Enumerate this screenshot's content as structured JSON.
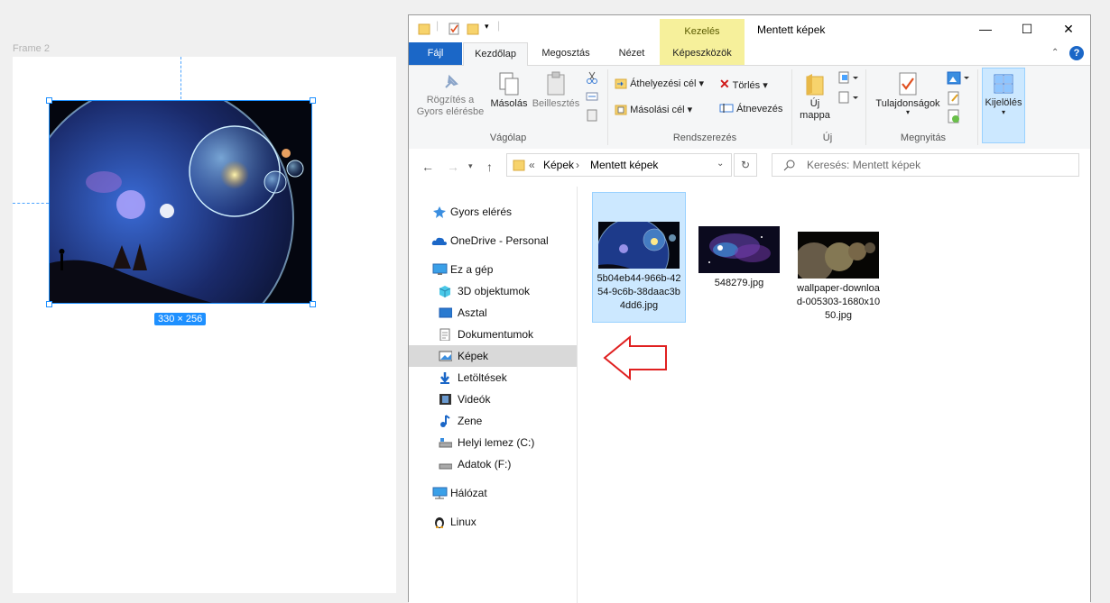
{
  "canvas": {
    "frame_label": "Frame 2",
    "size_tag": "330 × 256"
  },
  "window": {
    "title": "Mentett képek",
    "context_tab": "Kezelés",
    "controls": {
      "minimize": "—",
      "maximize": "☐",
      "close": "✕"
    }
  },
  "tabs": {
    "file": "Fájl",
    "home": "Kezdőlap",
    "share": "Megosztás",
    "view": "Nézet",
    "picture_tools": "Képeszközök"
  },
  "ribbon": {
    "clipboard": {
      "label": "Vágólap",
      "pin": "Rögzítés a Gyors elérésbe",
      "copy": "Másolás",
      "paste": "Beillesztés"
    },
    "organize": {
      "label": "Rendszerezés",
      "move_to": "Áthelyezési cél",
      "copy_to": "Másolási cél",
      "delete": "Törlés",
      "rename": "Átnevezés"
    },
    "new": {
      "label": "Új",
      "new_folder": "Új mappa"
    },
    "open": {
      "label": "Megnyitás",
      "properties": "Tulajdonságok"
    },
    "select": {
      "label": "Kijelölés"
    }
  },
  "address": {
    "prefix": "«",
    "crumb1": "Képek",
    "crumb2": "Mentett képek",
    "search_placeholder": "Keresés: Mentett képek"
  },
  "nav_pane": {
    "items": [
      {
        "label": "Gyors elérés"
      },
      {
        "label": "OneDrive - Personal"
      },
      {
        "label": "Ez a gép"
      },
      {
        "label": "3D objektumok"
      },
      {
        "label": "Asztal"
      },
      {
        "label": "Dokumentumok"
      },
      {
        "label": "Képek"
      },
      {
        "label": "Letöltések"
      },
      {
        "label": "Videók"
      },
      {
        "label": "Zene"
      },
      {
        "label": "Helyi lemez (C:)"
      },
      {
        "label": "Adatok (F:)"
      },
      {
        "label": "Hálózat"
      },
      {
        "label": "Linux"
      }
    ]
  },
  "files": [
    {
      "name": "5b04eb44-966b-4254-9c6b-38daac3b4dd6.jpg"
    },
    {
      "name": "548279.jpg"
    },
    {
      "name": "wallpaper-download-005303-1680x1050.jpg"
    }
  ],
  "colors": {
    "accent": "#1b67c7",
    "selection": "#cce8ff",
    "context_tab": "#f6f09b",
    "arrow": "#e02020"
  }
}
